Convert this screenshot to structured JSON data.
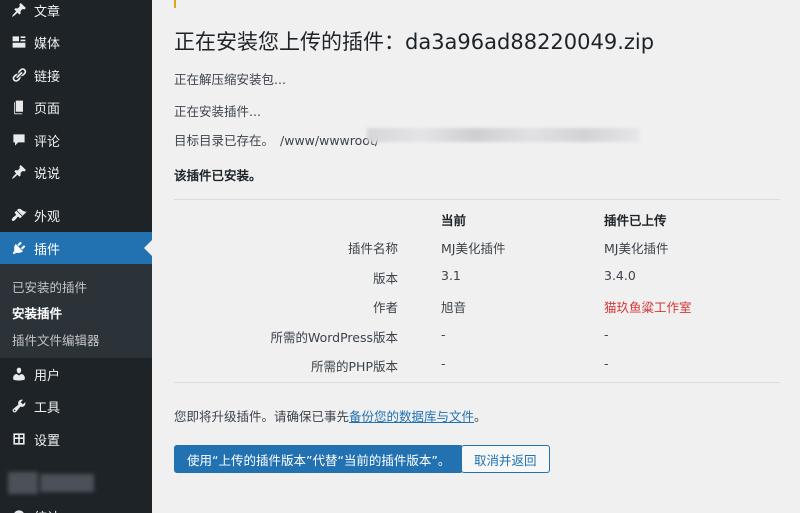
{
  "sidebar": {
    "items": [
      {
        "label": "文章",
        "icon": "pin-icon"
      },
      {
        "label": "媒体",
        "icon": "media-icon"
      },
      {
        "label": "链接",
        "icon": "link-icon"
      },
      {
        "label": "页面",
        "icon": "page-icon"
      },
      {
        "label": "评论",
        "icon": "comment-icon"
      },
      {
        "label": "说说",
        "icon": "pin-icon"
      },
      {
        "label": "外观",
        "icon": "brush-icon"
      },
      {
        "label": "插件",
        "icon": "plugin-icon"
      },
      {
        "label": "用户",
        "icon": "user-icon"
      },
      {
        "label": "工具",
        "icon": "wrench-icon"
      },
      {
        "label": "设置",
        "icon": "settings-icon"
      }
    ],
    "submenu": [
      {
        "label": "已安装的插件"
      },
      {
        "label": "安装插件"
      },
      {
        "label": "插件文件编辑器"
      }
    ],
    "bottom_partial_label": "统计"
  },
  "main": {
    "title": "正在安装您上传的插件：da3a96ad88220049.zip",
    "messages": {
      "unpacking": "正在解压缩安装包...",
      "installing": "正在安装插件...",
      "dir_exists": "目标目录已存在。",
      "dir_path": "/www/wwwroot/",
      "already_installed": "该插件已安装。"
    },
    "compare": {
      "col_current": "当前",
      "col_uploaded": "插件已上传",
      "rows": [
        {
          "label": "插件名称",
          "current": "MJ美化插件",
          "uploaded": "MJ美化插件"
        },
        {
          "label": "版本",
          "current": "3.1",
          "uploaded": "3.4.0"
        },
        {
          "label": "作者",
          "current": "旭音",
          "uploaded": "猫玖鱼粱工作室"
        },
        {
          "label": "所需的WordPress版本",
          "current": "-",
          "uploaded": "-"
        },
        {
          "label": "所需的PHP版本",
          "current": "-",
          "uploaded": "-"
        }
      ]
    },
    "notice": {
      "text": "您即将升级插件。请确保已事先",
      "link": "备份您的数据库与文件",
      "end": "。"
    },
    "buttons": {
      "replace": "使用“上传的插件版本”代替“当前的插件版本”。",
      "cancel": "取消并返回"
    }
  },
  "colors": {
    "sidebar_bg": "#1d2327",
    "accent": "#2271b1",
    "warning_red": "#d63638"
  }
}
